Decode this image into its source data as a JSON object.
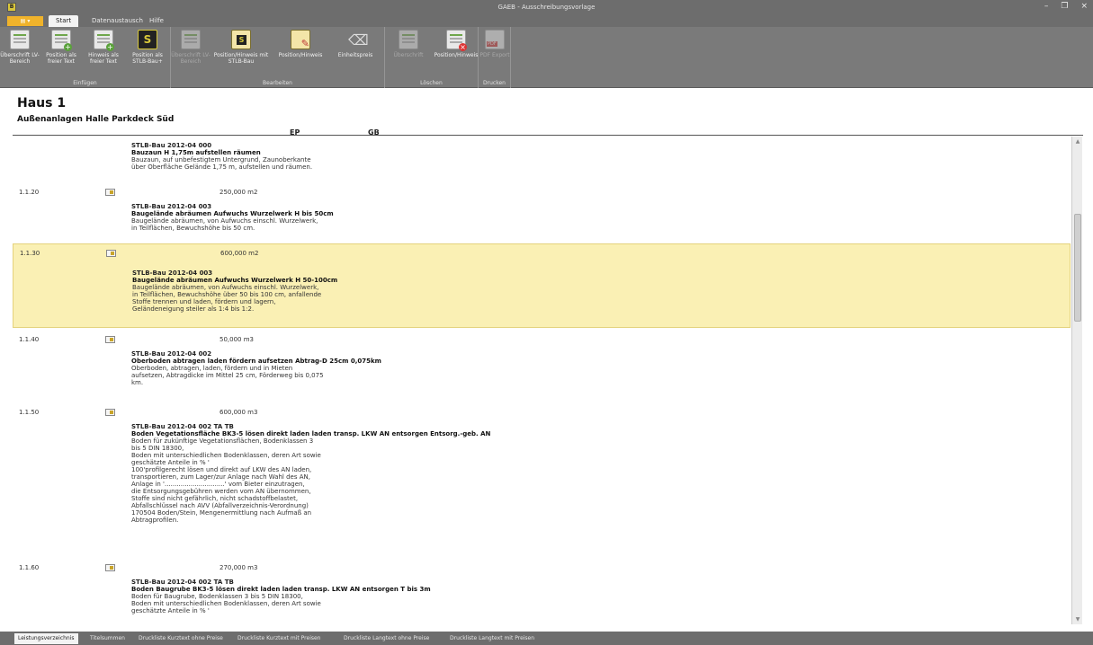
{
  "window": {
    "title": "GAEB - Ausschreibungsvorlage",
    "app_icon": "app-logo-icon"
  },
  "menu": {
    "file_label": "",
    "tabs": [
      {
        "label": "Start",
        "active": true
      },
      {
        "label": "Datenaustausch",
        "active": false
      },
      {
        "label": "Hilfe",
        "active": false
      }
    ]
  },
  "ribbon": {
    "groups": [
      {
        "label": "Einfügen",
        "buttons": [
          {
            "label": "Überschrift LV-Bereich",
            "icon": "section-heading-add-icon",
            "disabled": false
          },
          {
            "label": "Position als freier Text",
            "icon": "position-add-icon",
            "disabled": false
          },
          {
            "label": "Hinweis als freier Text",
            "icon": "note-add-icon",
            "disabled": false
          },
          {
            "label": "Position als STLB-Bau+",
            "icon": "stlb-icon",
            "disabled": false
          }
        ]
      },
      {
        "label": "Bearbeiten",
        "buttons": [
          {
            "label": "Überschrift LV-Bereich",
            "icon": "section-heading-edit-icon",
            "disabled": true
          },
          {
            "label": "Position/Hinweis mit STLB-Bau",
            "icon": "stlb-document-icon",
            "disabled": false
          },
          {
            "label": "Position/Hinweis",
            "icon": "edit-pen-icon",
            "disabled": false
          },
          {
            "label": "Einheitspreis",
            "icon": "eraser-icon",
            "disabled": false
          }
        ]
      },
      {
        "label": "Löschen",
        "buttons": [
          {
            "label": "Überschrift",
            "icon": "section-heading-delete-icon",
            "disabled": true
          },
          {
            "label": "Position/Hinweis",
            "icon": "position-delete-icon",
            "disabled": false
          }
        ]
      },
      {
        "label": "Drucken",
        "buttons": [
          {
            "label": "PDF Export",
            "icon": "pdf-icon",
            "disabled": true
          }
        ]
      }
    ]
  },
  "document": {
    "house": "Haus 1",
    "section": "Außenanlagen Halle Parkdeck Süd",
    "col_ep": "EP",
    "col_gb": "GB"
  },
  "entries": [
    {
      "pos": "",
      "qty": "",
      "stlb": "STLB-Bau 2012-04 000",
      "title": "Bauzaun H 1,75m aufstellen räumen",
      "lines": [
        "Bauzaun, auf unbefestigtem Untergrund, Zaunoberkante",
        "über Oberfläche Gelände 1,75 m, aufstellen und räumen."
      ],
      "selected": false
    },
    {
      "pos": "1.1.20",
      "qty": "250,000  m2",
      "stlb": "STLB-Bau 2012-04 003",
      "title": "Baugelände abräumen Aufwuchs Wurzelwerk H bis 50cm",
      "lines": [
        "Baugelände abräumen, von Aufwuchs einschl. Wurzelwerk,",
        "in Teilflächen, Bewuchshöhe bis 50 cm."
      ],
      "selected": false
    },
    {
      "pos": "1.1.30",
      "qty": "600,000  m2",
      "stlb": "STLB-Bau 2012-04 003",
      "title": "Baugelände abräumen Aufwuchs Wurzelwerk H 50-100cm",
      "lines": [
        "Baugelände abräumen, von Aufwuchs einschl. Wurzelwerk,",
        "in Teilflächen, Bewuchshöhe über 50 bis 100 cm, anfallende",
        "Stoffe trennen und laden, fördern und lagern,",
        "Geländeneigung steiler als 1:4 bis 1:2."
      ],
      "selected": true
    },
    {
      "pos": "1.1.40",
      "qty": "50,000  m3",
      "stlb": "STLB-Bau 2012-04 002",
      "title": "Oberboden abtragen laden fördern aufsetzen Abtrag-D 25cm 0,075km",
      "lines": [
        "Oberboden, abtragen, laden, fördern und in Mieten",
        "aufsetzen, Abtragdicke im Mittel 25 cm, Förderweg bis 0,075",
        "km."
      ],
      "selected": false
    },
    {
      "pos": "1.1.50",
      "qty": "600,000  m3",
      "stlb": "STLB-Bau 2012-04 002 TA TB",
      "title": "Boden Vegetationsfläche BK3-5 lösen direkt laden laden transp. LKW AN entsorgen Entsorg.-geb. AN",
      "lines": [
        "Boden für zukünftige Vegetationsflächen, Bodenklassen 3",
        "bis 5 DIN 18300,",
        "Boden mit unterschiedlichen Bodenklassen, deren Art sowie",
        "geschätzte Anteile in % '",
        "100'profilgerecht lösen und direkt auf LKW des AN laden,",
        "transportieren, zum Lager/zur Anlage nach Wahl des AN,",
        "Anlage in '..............................' vom Bieter einzutragen,",
        "die Entsorgungsgebühren werden vom AN übernommen,",
        "Stoffe sind nicht gefährlich, nicht schadstoffbelastet,",
        "Abfallschlüssel nach AVV (Abfallverzeichnis-Verordnung)",
        "170504 Boden/Stein, Mengenermittlung nach Aufmaß an",
        "Abtragprofilen."
      ],
      "selected": false
    },
    {
      "pos": "1.1.60",
      "qty": "270,000  m3",
      "stlb": "STLB-Bau 2012-04 002 TA TB",
      "title": "Boden Baugrube BK3-5 lösen direkt laden laden transp. LKW AN entsorgen T bis 3m",
      "lines": [
        "Boden für Baugrube, Bodenklassen 3 bis 5 DIN 18300,",
        "Boden mit unterschiedlichen Bodenklassen, deren Art sowie",
        "geschätzte Anteile in % '"
      ],
      "selected": false
    }
  ],
  "bottom_tabs": [
    {
      "label": "Leistungsverzeichnis",
      "active": true
    },
    {
      "label": "Titelsummen",
      "active": false
    },
    {
      "label": "Druckliste Kurztext ohne Preise",
      "active": false
    },
    {
      "label": "Druckliste Kurztext mit Preisen",
      "active": false
    },
    {
      "label": "Druckliste Langtext ohne Preise",
      "active": false
    },
    {
      "label": "Druckliste Langtext mit Preisen",
      "active": false
    }
  ]
}
